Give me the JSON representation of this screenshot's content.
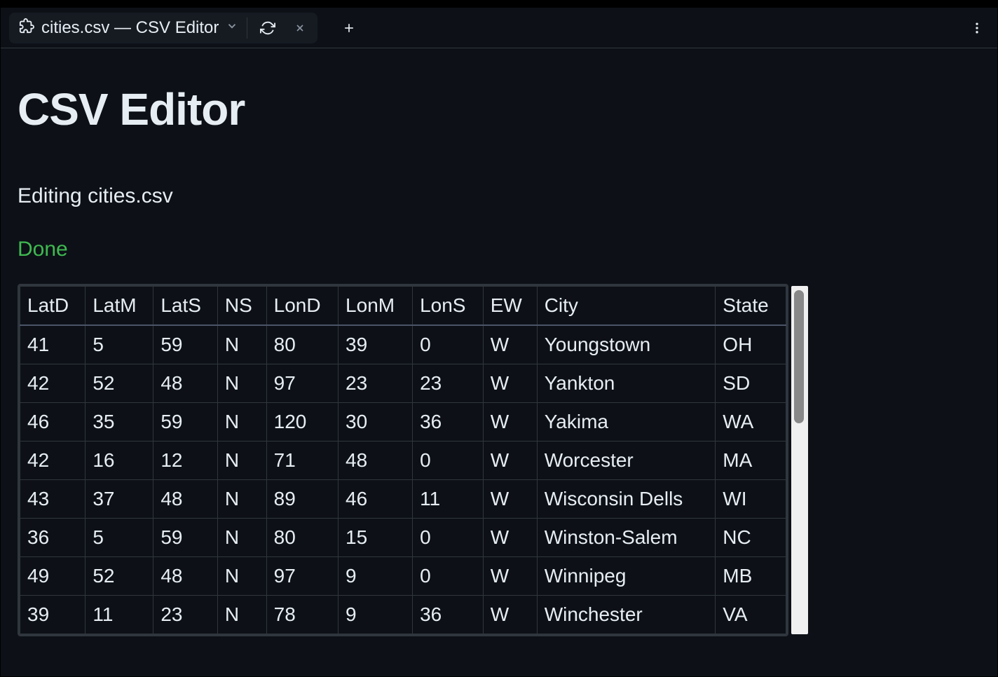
{
  "tab": {
    "title": "cities.csv — CSV Editor"
  },
  "page": {
    "title": "CSV Editor",
    "subtitle": "Editing cities.csv",
    "done_label": "Done"
  },
  "table": {
    "headers": [
      "LatD",
      "LatM",
      "LatS",
      "NS",
      "LonD",
      "LonM",
      "LonS",
      "EW",
      "City",
      "State"
    ],
    "rows": [
      [
        "41",
        "5",
        "59",
        "N",
        "80",
        "39",
        "0",
        "W",
        "Youngstown",
        "OH"
      ],
      [
        "42",
        "52",
        "48",
        "N",
        "97",
        "23",
        "23",
        "W",
        "Yankton",
        "SD"
      ],
      [
        "46",
        "35",
        "59",
        "N",
        "120",
        "30",
        "36",
        "W",
        "Yakima",
        "WA"
      ],
      [
        "42",
        "16",
        "12",
        "N",
        "71",
        "48",
        "0",
        "W",
        "Worcester",
        "MA"
      ],
      [
        "43",
        "37",
        "48",
        "N",
        "89",
        "46",
        "11",
        "W",
        "Wisconsin Dells",
        "WI"
      ],
      [
        "36",
        "5",
        "59",
        "N",
        "80",
        "15",
        "0",
        "W",
        "Winston-Salem",
        "NC"
      ],
      [
        "49",
        "52",
        "48",
        "N",
        "97",
        "9",
        "0",
        "W",
        "Winnipeg",
        "MB"
      ],
      [
        "39",
        "11",
        "23",
        "N",
        "78",
        "9",
        "36",
        "W",
        "Winchester",
        "VA"
      ]
    ]
  }
}
